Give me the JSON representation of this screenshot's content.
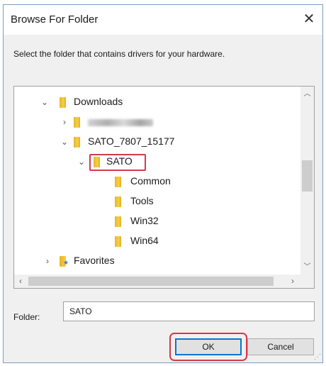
{
  "window": {
    "title": "Browse For Folder",
    "close_glyph": "✕"
  },
  "instruction": "Select the folder that contains drivers for your hardware.",
  "tree": {
    "items": [
      {
        "label": "Downloads",
        "expanded": true
      },
      {
        "label": "",
        "obscured": true,
        "expanded": false
      },
      {
        "label": "SATO_7807_15177",
        "expanded": true
      },
      {
        "label": "SATO",
        "expanded": true,
        "selected": true
      },
      {
        "label": "Common"
      },
      {
        "label": "Tools"
      },
      {
        "label": "Win32"
      },
      {
        "label": "Win64"
      },
      {
        "label": "Favorites",
        "expanded": false
      }
    ]
  },
  "folder_field": {
    "label": "Folder:",
    "value": "SATO"
  },
  "buttons": {
    "ok": "OK",
    "cancel": "Cancel"
  },
  "colors": {
    "highlight": "#d23a4a",
    "folder": "#f0c23a",
    "default_button_border": "#0078d7"
  },
  "icons": {
    "expand": "chevron-right-icon",
    "collapse": "chevron-down-icon",
    "folder": "folder-icon",
    "favorites": "favorites-folder-icon"
  }
}
